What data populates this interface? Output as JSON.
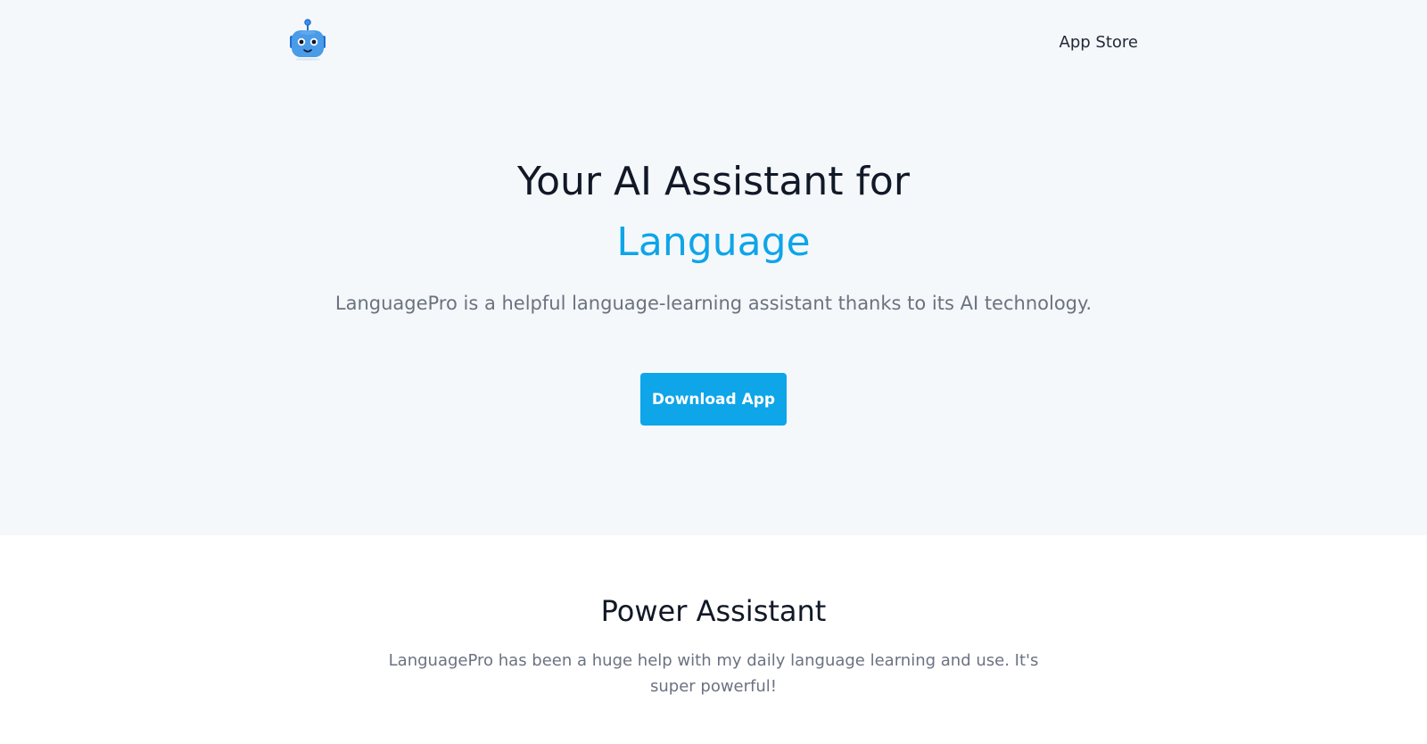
{
  "nav": {
    "logo_icon": "robot-logo-icon",
    "app_store_label": "App Store"
  },
  "hero": {
    "title": "Your AI Assistant for",
    "accent": "Language",
    "subtitle": "LanguagePro is a helpful language-learning assistant thanks to its AI technology.",
    "cta_label": "Download App"
  },
  "feature": {
    "title": "Power Assistant",
    "text": "LanguagePro has been a huge help with my daily language learning and use. It's super powerful!"
  },
  "colors": {
    "accent": "#0ea5e9",
    "hero_background": "#f5f8fa",
    "heading": "#111827",
    "muted": "#6b7280"
  }
}
